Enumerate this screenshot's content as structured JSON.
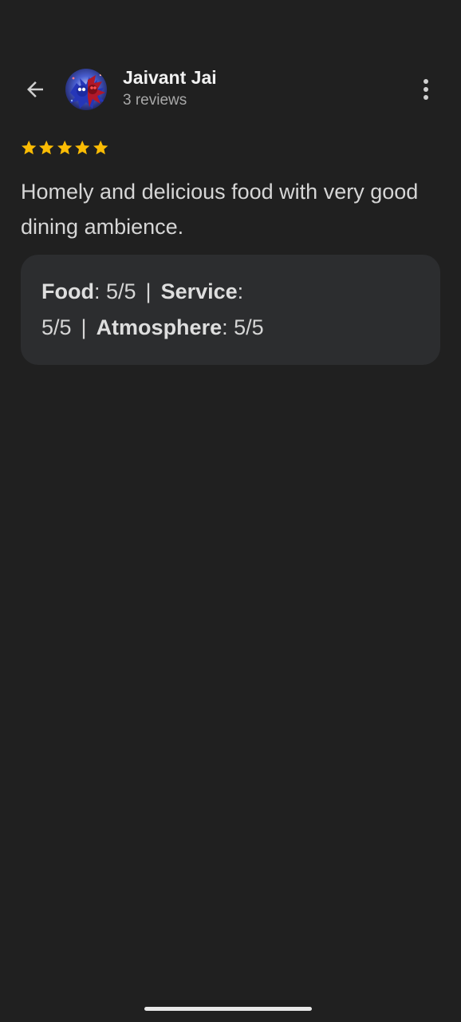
{
  "header": {
    "user_name": "Jaivant Jai",
    "review_count": "3 reviews",
    "back_icon": "arrow-left-icon",
    "menu_icon": "more-vertical-icon"
  },
  "review": {
    "star_rating": 5,
    "star_max": 5,
    "star_color": "#fbbc04",
    "text": "Homely and delicious food with very good dining ambience."
  },
  "ratings": {
    "items": [
      {
        "label": "Food",
        "value": "5/5"
      },
      {
        "label": "Service",
        "value": "5/5"
      },
      {
        "label": "Atmosphere",
        "value": "5/5"
      }
    ],
    "separator": "|"
  },
  "colors": {
    "background": "#202020",
    "card": "#2c2d2f",
    "text": "#d6d6d6",
    "secondary_text": "#a8a8a8"
  }
}
